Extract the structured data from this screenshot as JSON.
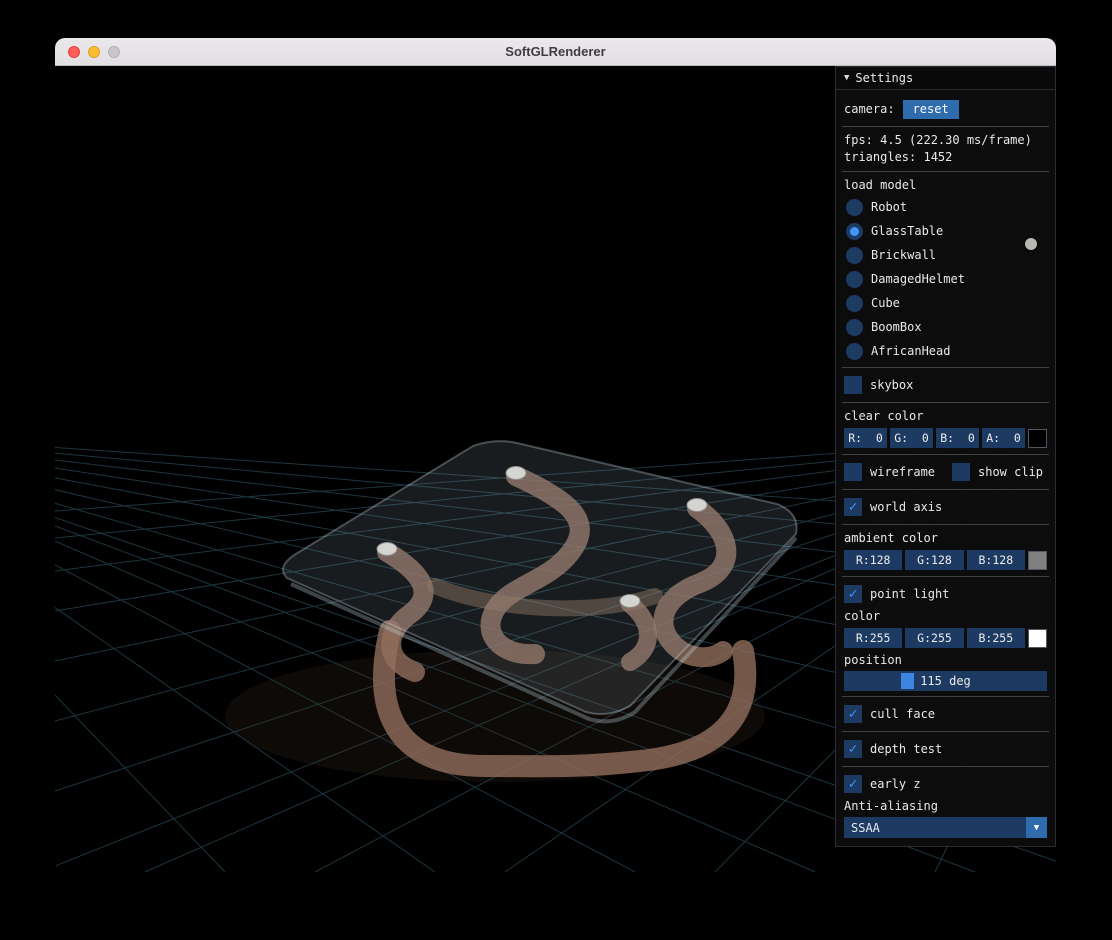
{
  "titlebar": {
    "title": "SoftGLRenderer"
  },
  "icons": {
    "collapse_arrow": "▼",
    "check": "✓",
    "combo_arrow": "▼"
  },
  "panel": {
    "header_label": "Settings",
    "camera": {
      "label": "camera:",
      "reset_button": "reset"
    },
    "stats": {
      "fps": "fps: 4.5 (222.30 ms/frame)",
      "triangles": "triangles: 1452"
    },
    "load_model": {
      "label": "load model",
      "options": [
        {
          "label": "Robot",
          "selected": false
        },
        {
          "label": "GlassTable",
          "selected": true
        },
        {
          "label": "Brickwall",
          "selected": false
        },
        {
          "label": "DamagedHelmet",
          "selected": false
        },
        {
          "label": "Cube",
          "selected": false
        },
        {
          "label": "BoomBox",
          "selected": false
        },
        {
          "label": "AfricanHead",
          "selected": false
        }
      ]
    },
    "skybox": {
      "label": "skybox",
      "checked": false
    },
    "clear_color": {
      "label": "clear color",
      "fields": [
        "R:  0",
        "G:  0",
        "B:  0",
        "A:  0"
      ],
      "swatch": "#000000"
    },
    "wireframe": {
      "label": "wireframe",
      "checked": false
    },
    "show_clip": {
      "label": "show clip",
      "checked": false
    },
    "world_axis": {
      "label": "world axis",
      "checked": true
    },
    "ambient_color": {
      "label": "ambient color",
      "fields": [
        "R:128",
        "G:128",
        "B:128"
      ],
      "swatch": "#808080"
    },
    "point_light": {
      "label": "point light",
      "checked": true
    },
    "light_color": {
      "label": "color",
      "fields": [
        "R:255",
        "G:255",
        "B:255"
      ],
      "swatch": "#ffffff"
    },
    "position": {
      "label": "position",
      "value": "115 deg"
    },
    "cull_face": {
      "label": "cull face",
      "checked": true
    },
    "depth_test": {
      "label": "depth test",
      "checked": true
    },
    "early_z": {
      "label": "early z",
      "checked": true
    },
    "anti_aliasing": {
      "label": "Anti-aliasing",
      "selected": "SSAA"
    }
  }
}
